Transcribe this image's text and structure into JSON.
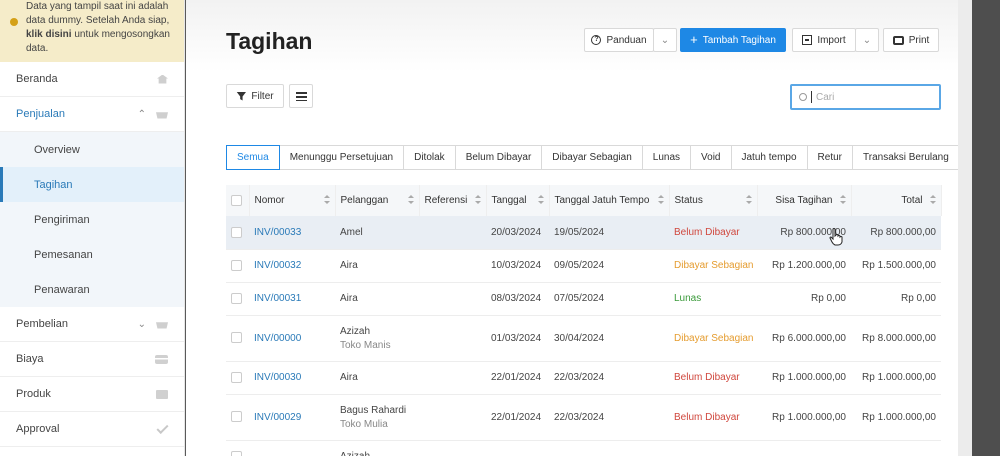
{
  "notice": {
    "lines": [
      "Data yang tampil saat ini adalah",
      "data dummy. Setelah Anda siap,",
      "untuk mengosongkan",
      "data."
    ],
    "link": "klik disini"
  },
  "sidebar": {
    "items": [
      {
        "label": "Beranda",
        "icon": "home-icon"
      },
      {
        "label": "Penjualan",
        "icon": "basket-icon",
        "expanded": true
      },
      {
        "label": "Pembelian",
        "icon": "shopping-bag-icon"
      },
      {
        "label": "Biaya",
        "icon": "credit-card-icon"
      },
      {
        "label": "Produk",
        "icon": "box-icon"
      },
      {
        "label": "Approval",
        "icon": "check-icon"
      }
    ],
    "sub": [
      {
        "label": "Overview",
        "icon": "pie-chart-icon"
      },
      {
        "label": "Tagihan",
        "icon": "tag-icon",
        "active": true
      },
      {
        "label": "Pengiriman",
        "icon": "tag-icon"
      },
      {
        "label": "Pemesanan",
        "icon": "tag-icon"
      },
      {
        "label": "Penawaran",
        "icon": "tag-icon"
      }
    ]
  },
  "header": {
    "title": "Tagihan",
    "guide": "Panduan",
    "add": "Tambah Tagihan",
    "import": "Import",
    "print": "Print"
  },
  "toolbar": {
    "filter": "Filter",
    "search_placeholder": "Cari"
  },
  "tabs": [
    "Semua",
    "Menunggu Persetujuan",
    "Ditolak",
    "Belum Dibayar",
    "Dibayar Sebagian",
    "Lunas",
    "Void",
    "Jatuh tempo",
    "Retur",
    "Transaksi Berulang"
  ],
  "table": {
    "columns": [
      "Nomor",
      "Pelanggan",
      "Referensi",
      "Tanggal",
      "Tanggal Jatuh Tempo",
      "Status",
      "Sisa Tagihan",
      "Total"
    ],
    "rows": [
      {
        "nomor": "INV/00033",
        "pelanggan": "Amel",
        "perusahaan": "",
        "referensi": "",
        "tanggal": "20/03/2024",
        "jatuh_tempo": "19/05/2024",
        "status": "Belum Dibayar",
        "status_color": "#d0473d",
        "sisa": "Rp 800.000,00",
        "total": "Rp 800.000,00"
      },
      {
        "nomor": "INV/00032",
        "pelanggan": "Aira",
        "perusahaan": "",
        "referensi": "",
        "tanggal": "10/03/2024",
        "jatuh_tempo": "09/05/2024",
        "status": "Dibayar Sebagian",
        "status_color": "#e59c2f",
        "sisa": "Rp 1.200.000,00",
        "total": "Rp 1.500.000,00"
      },
      {
        "nomor": "INV/00031",
        "pelanggan": "Aira",
        "perusahaan": "",
        "referensi": "",
        "tanggal": "08/03/2024",
        "jatuh_tempo": "07/05/2024",
        "status": "Lunas",
        "status_color": "#3a9a3a",
        "sisa": "Rp 0,00",
        "total": "Rp 0,00"
      },
      {
        "nomor": "INV/00000",
        "pelanggan": "Azizah",
        "perusahaan": "Toko Manis",
        "referensi": "",
        "tanggal": "01/03/2024",
        "jatuh_tempo": "30/04/2024",
        "status": "Dibayar Sebagian",
        "status_color": "#e59c2f",
        "sisa": "Rp 6.000.000,00",
        "total": "Rp 8.000.000,00"
      },
      {
        "nomor": "INV/00030",
        "pelanggan": "Aira",
        "perusahaan": "",
        "referensi": "",
        "tanggal": "22/01/2024",
        "jatuh_tempo": "22/03/2024",
        "status": "Belum Dibayar",
        "status_color": "#d0473d",
        "sisa": "Rp 1.000.000,00",
        "total": "Rp 1.000.000,00"
      },
      {
        "nomor": "INV/00029",
        "pelanggan": "Bagus Rahardi",
        "perusahaan": "Toko Mulia",
        "referensi": "",
        "tanggal": "22/01/2024",
        "jatuh_tempo": "22/03/2024",
        "status": "Belum Dibayar",
        "status_color": "#d0473d",
        "sisa": "Rp 1.000.000,00",
        "total": "Rp 1.000.000,00"
      },
      {
        "nomor": "",
        "pelanggan": "Azizah",
        "perusahaan": "",
        "referensi": "",
        "tanggal": "",
        "jatuh_tempo": "",
        "status": "",
        "status_color": "#d0473d",
        "sisa": "",
        "total": ""
      }
    ]
  }
}
